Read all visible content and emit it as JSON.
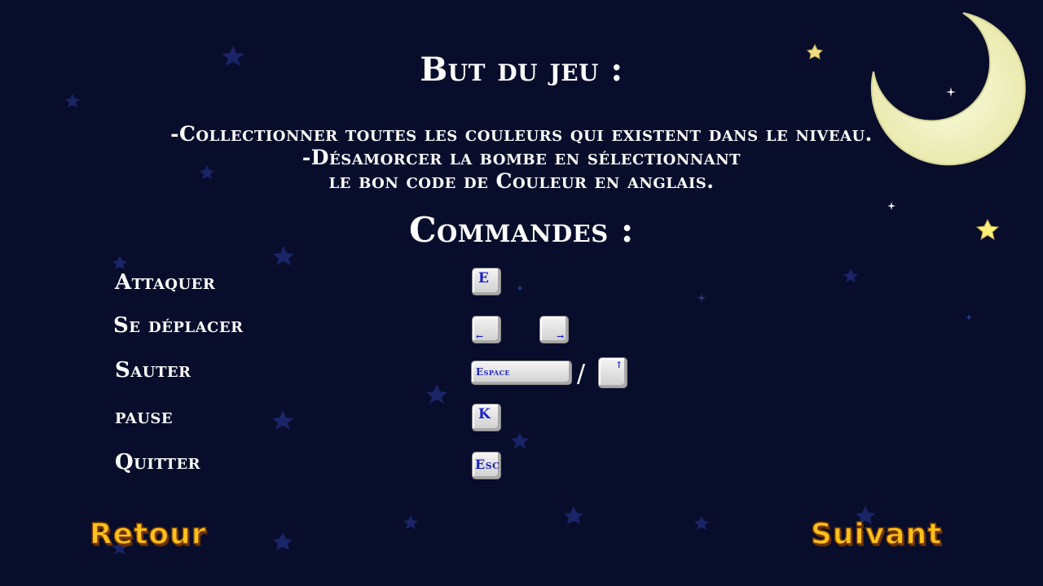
{
  "goal": {
    "title": "But du jeu  :",
    "line1": "-Collectionner toutes les couleurs qui existent dans le niveau.",
    "line2": "-Désamorcer la bombe en sélectionnant",
    "line3": "le bon code de Couleur en anglais."
  },
  "commands": {
    "title": "Commandes :",
    "attack": {
      "label": "Attaquer",
      "key": "E"
    },
    "move": {
      "label": "Se déplacer",
      "left_arrow": "←",
      "right_arrow": "→"
    },
    "jump": {
      "label": "Sauter",
      "key": "Espace",
      "separator": "/",
      "up_arrow": "↑"
    },
    "pause": {
      "label": "pause",
      "key": "K"
    },
    "quit": {
      "label": "Quitter",
      "key": "Esc"
    }
  },
  "nav": {
    "back_label": "Retour",
    "next_label": "Suivant"
  },
  "colors": {
    "background": "#080d2b",
    "moon": "#f7f5c8",
    "button_text": "#ffc21a",
    "key_text": "#1a1fc7"
  }
}
